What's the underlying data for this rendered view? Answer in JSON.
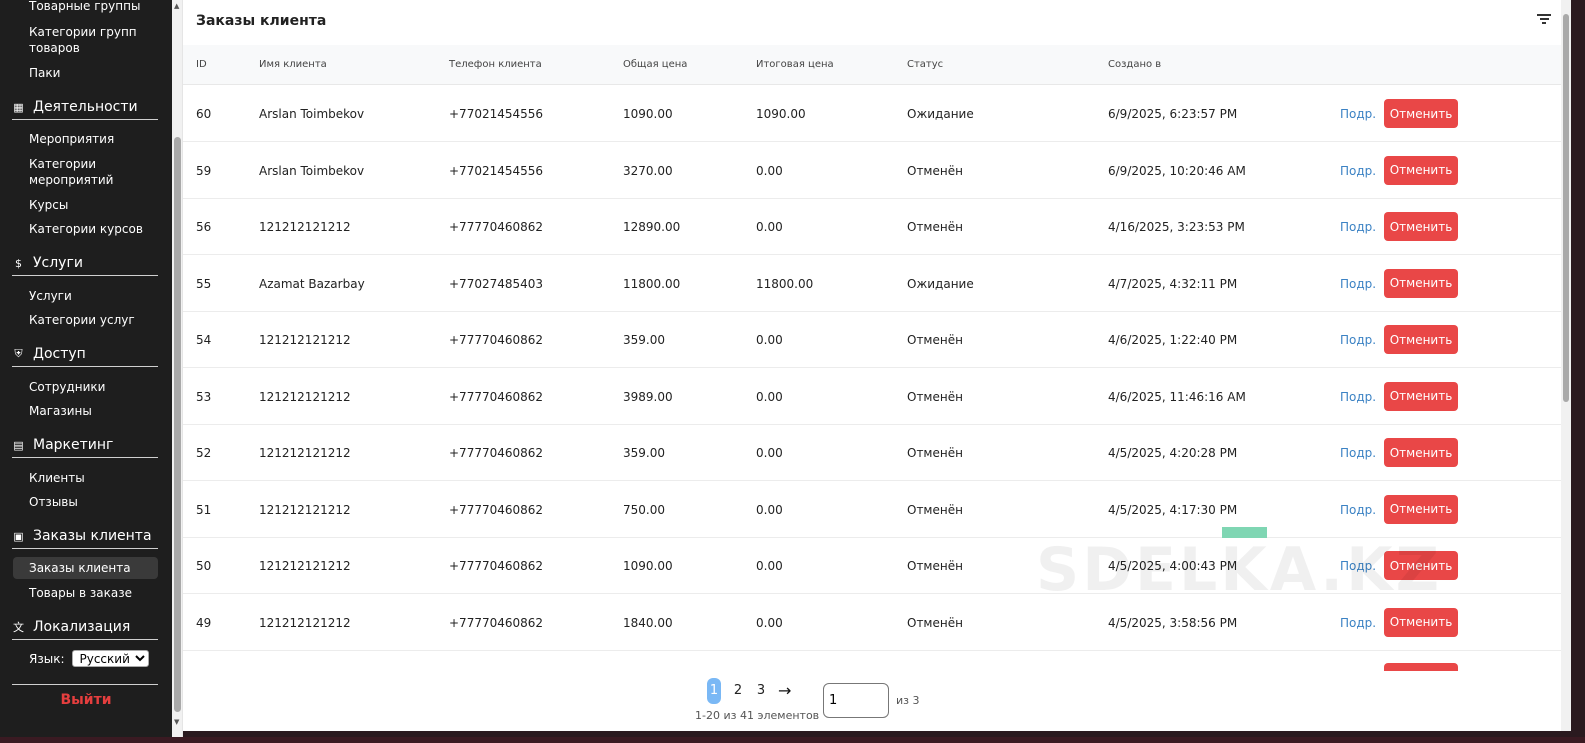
{
  "sidebar": {
    "top_items": [
      "Товарные группы",
      "Категории групп товаров",
      "Паки"
    ],
    "sections": [
      {
        "label": "Деятельности",
        "icon": "calendar-icon",
        "items": [
          "Мероприятия",
          "Категории мероприятий",
          "Курсы",
          "Категории курсов"
        ]
      },
      {
        "label": "Услуги",
        "icon": "dollar-circle-icon",
        "items": [
          "Услуги",
          "Категории услуг"
        ]
      },
      {
        "label": "Доступ",
        "icon": "shield-icon",
        "items": [
          "Сотрудники",
          "Магазины"
        ]
      },
      {
        "label": "Маркетинг",
        "icon": "message-icon",
        "items": [
          "Клиенты",
          "Отзывы"
        ]
      },
      {
        "label": "Заказы клиента",
        "icon": "receipt-icon",
        "items": [
          "Заказы клиента",
          "Товары в заказе"
        ]
      },
      {
        "label": "Локализация",
        "icon": "translate-icon",
        "items": []
      }
    ],
    "language_label": "Язык:",
    "language_value": "Русский",
    "logout_label": "Выйти"
  },
  "main": {
    "title": "Заказы клиента",
    "columns": [
      "ID",
      "Имя клиента",
      "Телефон клиента",
      "Общая цена",
      "Итоговая цена",
      "Статус",
      "Создано в"
    ],
    "details_label": "Подр.",
    "cancel_label": "Отменить",
    "rows": [
      [
        "60",
        "Arslan Toimbekov",
        "+77021454556",
        "1090.00",
        "1090.00",
        "Ожидание",
        "6/9/2025, 6:23:57 PM"
      ],
      [
        "59",
        "Arslan Toimbekov",
        "+77021454556",
        "3270.00",
        "0.00",
        "Отменён",
        "6/9/2025, 10:20:46 AM"
      ],
      [
        "56",
        "121212121212",
        "+77770460862",
        "12890.00",
        "0.00",
        "Отменён",
        "4/16/2025, 3:23:53 PM"
      ],
      [
        "55",
        "Azamat Bazarbay",
        "+77027485403",
        "11800.00",
        "11800.00",
        "Ожидание",
        "4/7/2025, 4:32:11 PM"
      ],
      [
        "54",
        "121212121212",
        "+77770460862",
        "359.00",
        "0.00",
        "Отменён",
        "4/6/2025, 1:22:40 PM"
      ],
      [
        "53",
        "121212121212",
        "+77770460862",
        "3989.00",
        "0.00",
        "Отменён",
        "4/6/2025, 11:46:16 AM"
      ],
      [
        "52",
        "121212121212",
        "+77770460862",
        "359.00",
        "0.00",
        "Отменён",
        "4/5/2025, 4:20:28 PM"
      ],
      [
        "51",
        "121212121212",
        "+77770460862",
        "750.00",
        "0.00",
        "Отменён",
        "4/5/2025, 4:17:30 PM"
      ],
      [
        "50",
        "121212121212",
        "+77770460862",
        "1090.00",
        "0.00",
        "Отменён",
        "4/5/2025, 4:00:43 PM"
      ],
      [
        "49",
        "121212121212",
        "+77770460862",
        "1840.00",
        "0.00",
        "Отменён",
        "4/5/2025, 3:58:56 PM"
      ]
    ]
  },
  "pagination": {
    "pages": [
      "1",
      "2",
      "3"
    ],
    "current": "1",
    "next_icon": "arrow-right-icon",
    "summary": "1-20 из 41 элементов",
    "input_value": "1",
    "of_label": "из 3"
  },
  "watermark": "SDELKA.KZ",
  "colors": {
    "sidebar_bg": "#1e1e1e",
    "cancel_button": "#e94747",
    "link": "#3b82c4",
    "active_page": "#7ab8f5",
    "logout": "#e53e3e"
  }
}
